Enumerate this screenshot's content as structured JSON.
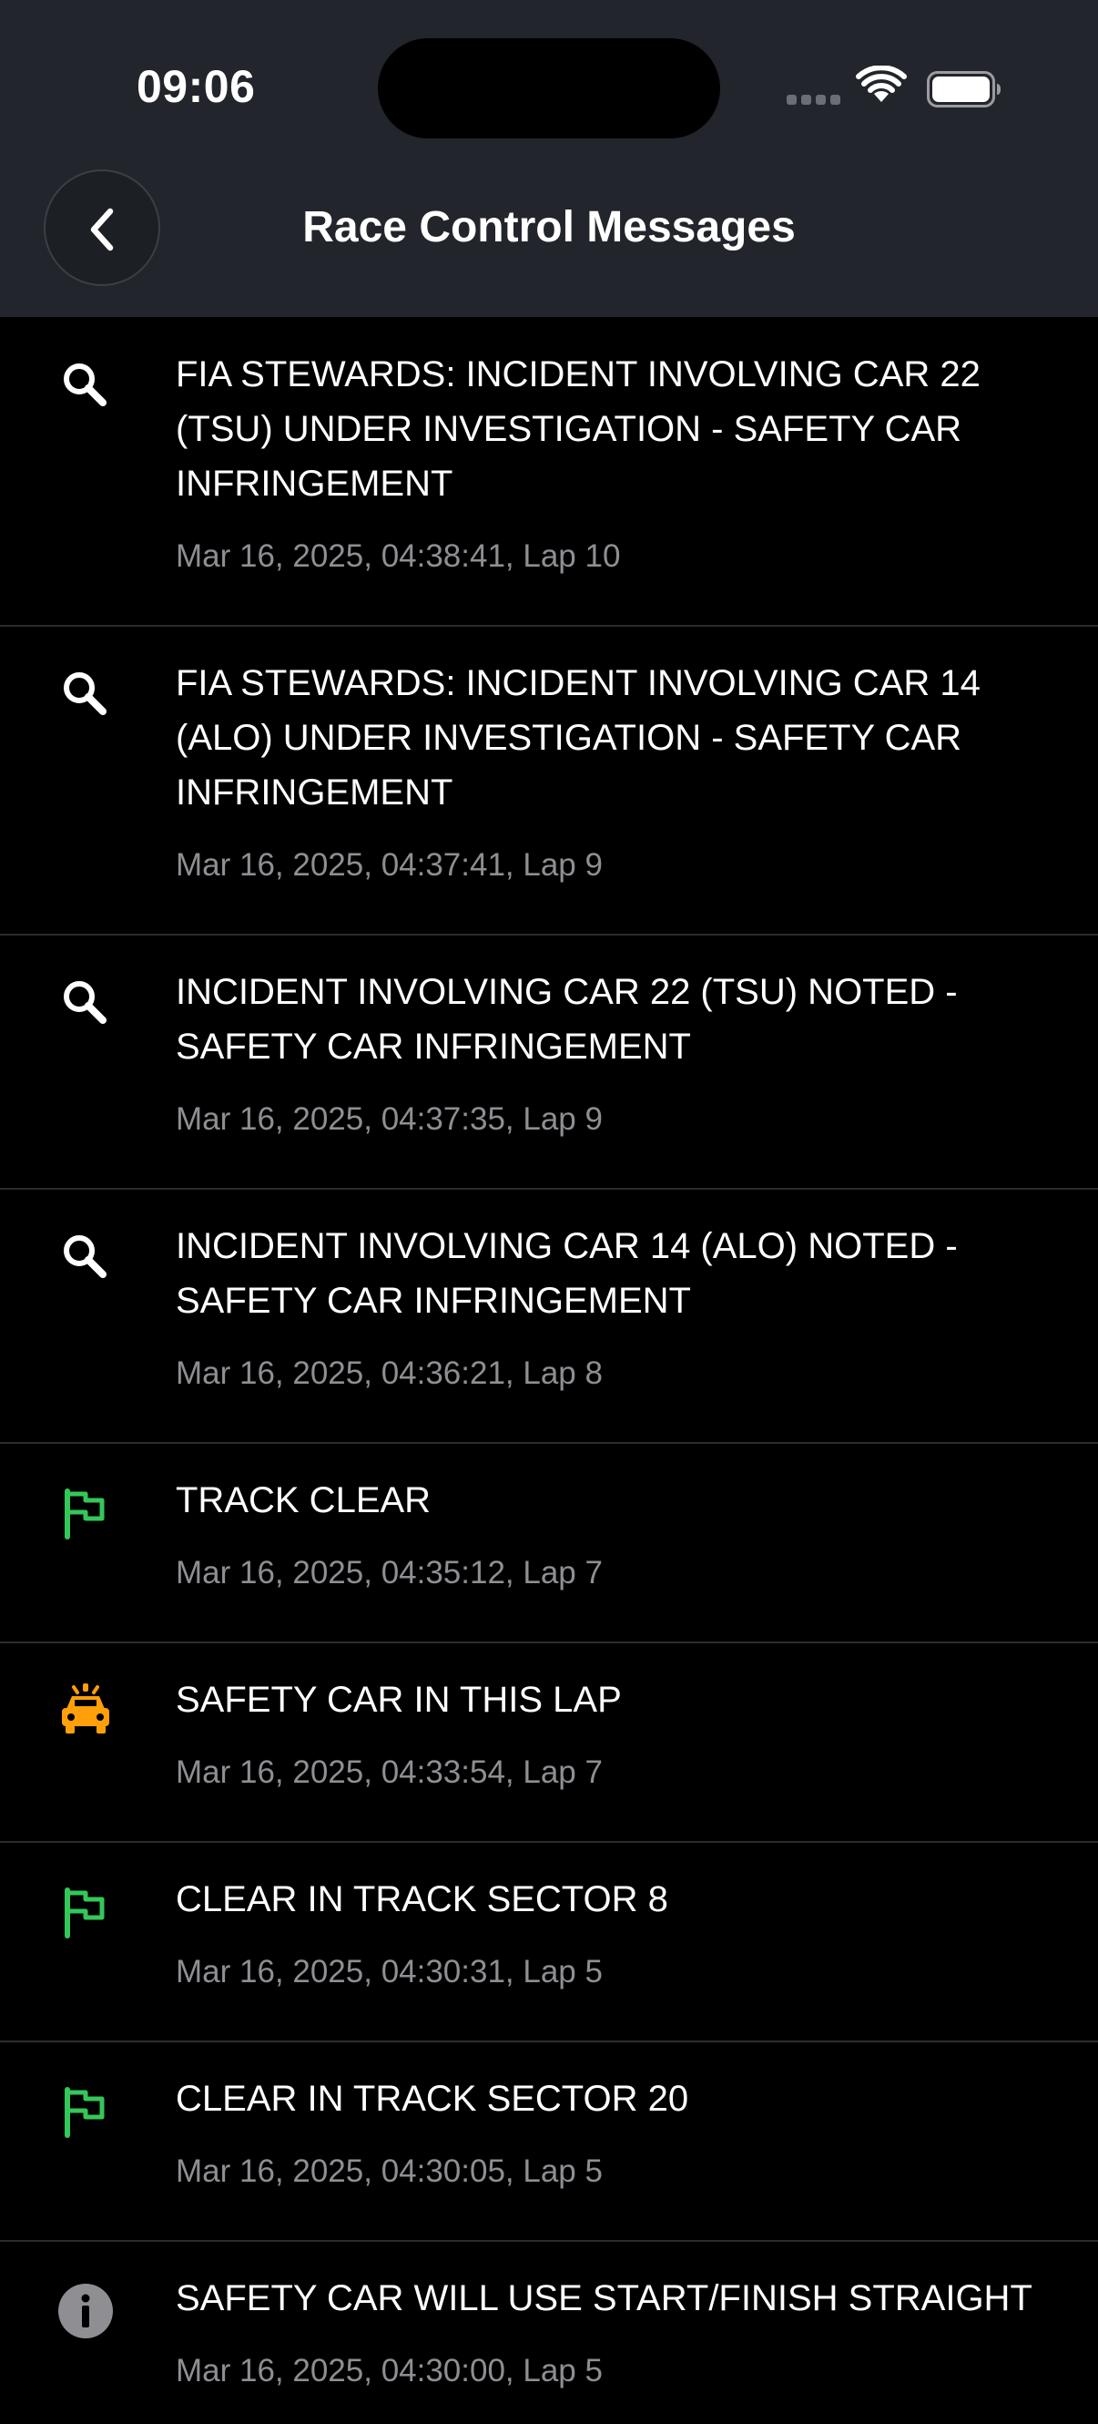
{
  "status_bar": {
    "time": "09:06"
  },
  "nav": {
    "title": "Race Control Messages"
  },
  "colors": {
    "flag_green": "#34c759",
    "safety_car_orange": "#ff9f0a",
    "info_grey": "#8e8e93"
  },
  "messages": [
    {
      "icon": "magnifier-icon",
      "text": "FIA STEWARDS: INCIDENT INVOLVING CAR 22 (TSU) UNDER INVESTIGATION - SAFETY CAR INFRINGEMENT",
      "meta": "Mar 16, 2025, 04:38:41, Lap 10"
    },
    {
      "icon": "magnifier-icon",
      "text": "FIA STEWARDS: INCIDENT INVOLVING CAR 14 (ALO) UNDER INVESTIGATION - SAFETY CAR INFRINGEMENT",
      "meta": "Mar 16, 2025, 04:37:41, Lap 9"
    },
    {
      "icon": "magnifier-icon",
      "text": "INCIDENT INVOLVING CAR 22 (TSU) NOTED - SAFETY CAR INFRINGEMENT",
      "meta": "Mar 16, 2025, 04:37:35, Lap 9"
    },
    {
      "icon": "magnifier-icon",
      "text": "INCIDENT INVOLVING CAR 14 (ALO) NOTED - SAFETY CAR INFRINGEMENT",
      "meta": "Mar 16, 2025, 04:36:21, Lap 8"
    },
    {
      "icon": "green-flag-icon",
      "text": "TRACK CLEAR",
      "meta": "Mar 16, 2025, 04:35:12, Lap 7"
    },
    {
      "icon": "safety-car-icon",
      "text": "SAFETY CAR IN THIS LAP",
      "meta": "Mar 16, 2025, 04:33:54, Lap 7"
    },
    {
      "icon": "green-flag-icon",
      "text": "CLEAR IN TRACK SECTOR 8",
      "meta": "Mar 16, 2025, 04:30:31, Lap 5"
    },
    {
      "icon": "green-flag-icon",
      "text": "CLEAR IN TRACK SECTOR 20",
      "meta": "Mar 16, 2025, 04:30:05, Lap 5"
    },
    {
      "icon": "info-icon",
      "text": "SAFETY CAR WILL USE START/FINISH STRAIGHT",
      "meta": "Mar 16, 2025, 04:30:00, Lap 5"
    }
  ]
}
